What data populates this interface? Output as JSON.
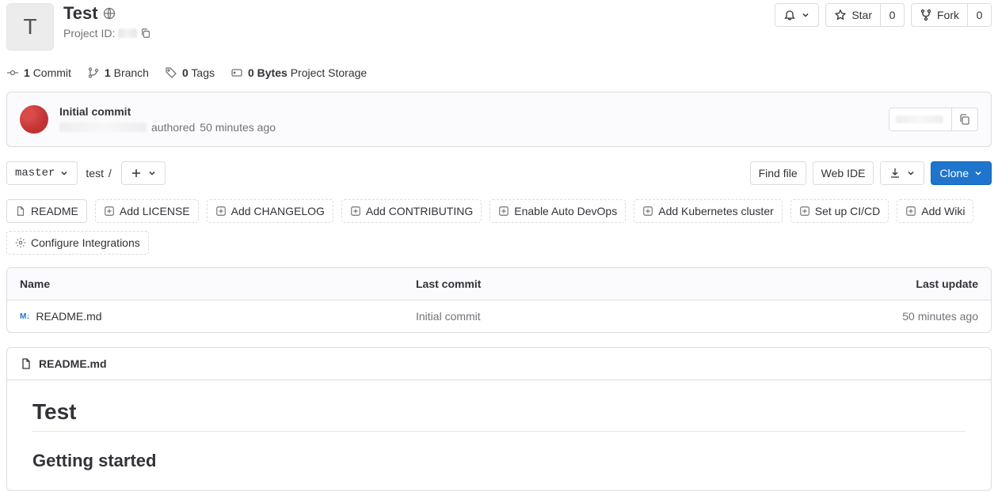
{
  "project": {
    "avatar_letter": "T",
    "title": "Test",
    "sub_label": "Project ID:"
  },
  "header_actions": {
    "star_label": "Star",
    "star_count": "0",
    "fork_label": "Fork",
    "fork_count": "0"
  },
  "stats": {
    "commits_count": "1",
    "commits_label": "Commit",
    "branches_count": "1",
    "branches_label": "Branch",
    "tags_count": "0",
    "tags_label": "Tags",
    "storage_count": "0 Bytes",
    "storage_label": "Project Storage"
  },
  "commit": {
    "title": "Initial commit",
    "authored": "authored",
    "when": "50 minutes ago"
  },
  "controls": {
    "branch": "master",
    "path_root": "test",
    "find_file": "Find file",
    "web_ide": "Web IDE",
    "clone": "Clone"
  },
  "chips": {
    "readme": "README",
    "add_license": "Add LICENSE",
    "add_changelog": "Add CHANGELOG",
    "add_contributing": "Add CONTRIBUTING",
    "enable_autodevops": "Enable Auto DevOps",
    "add_k8s": "Add Kubernetes cluster",
    "setup_cicd": "Set up CI/CD",
    "add_wiki": "Add Wiki",
    "configure_integrations": "Configure Integrations"
  },
  "files": {
    "col_name": "Name",
    "col_commit": "Last commit",
    "col_update": "Last update",
    "rows": [
      {
        "name": "README.md",
        "commit": "Initial commit",
        "updated": "50 minutes ago"
      }
    ]
  },
  "readme": {
    "filename": "README.md",
    "h1": "Test",
    "h2": "Getting started"
  }
}
